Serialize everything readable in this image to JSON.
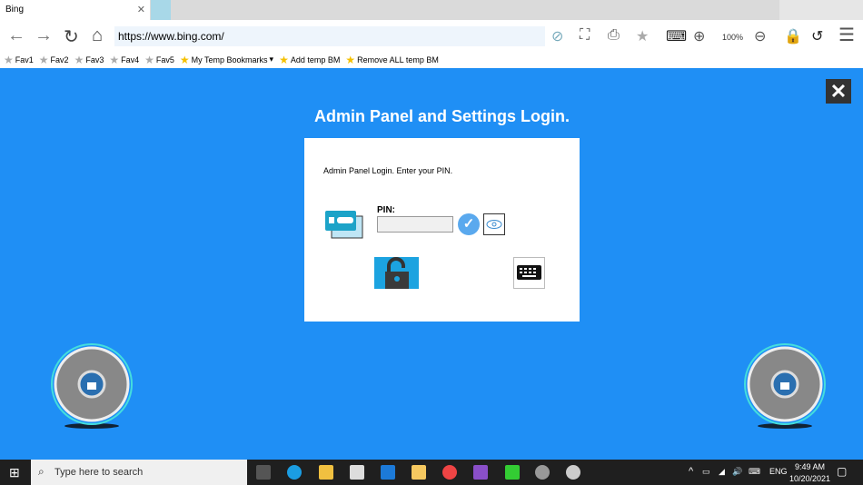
{
  "browser": {
    "tab_title": "Bing",
    "url": "https://www.bing.com/",
    "zoom": "100%"
  },
  "favorites": [
    "Fav1",
    "Fav2",
    "Fav3",
    "Fav4",
    "Fav5",
    "My Temp Bookmarks",
    "Add temp BM",
    "Remove ALL temp BM"
  ],
  "page": {
    "title": "Admin Panel and Settings Login.",
    "instruction": "Admin Panel Login. Enter your PIN.",
    "pin_label": "PIN:",
    "pin_value": ""
  },
  "taskbar": {
    "search_placeholder": "Type here to search",
    "lang": "ENG",
    "time": "9:49 AM",
    "date": "10/20/2021"
  },
  "colors": {
    "background": "#1f8ff5",
    "unlock": "#1ca3e0"
  }
}
